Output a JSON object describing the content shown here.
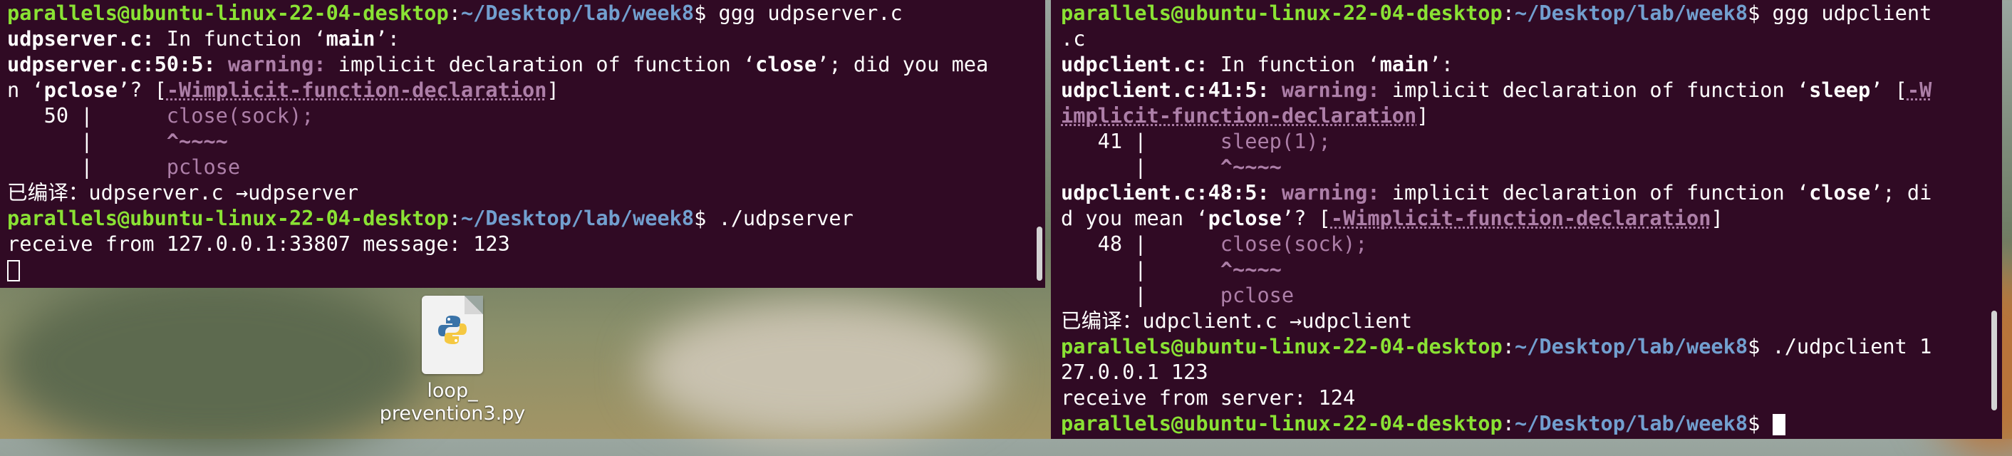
{
  "desktop": {
    "file_name": "loop_\nprevention3.py",
    "file_icon": "python-file-icon"
  },
  "left_terminal": {
    "lines": [
      {
        "prompt_user": "parallels@ubuntu-linux-22-04-desktop",
        "prompt_sep": ":",
        "prompt_path": "~/Desktop/lab/week8",
        "prompt_end": "$ ",
        "cmd": "ggg udpserver.c"
      },
      {
        "file": "udpserver.c:",
        "text": " In function ",
        "q1": "‘",
        "func": "main",
        "q2": "’:"
      },
      {
        "loc": "udpserver.c:50:5:",
        "warn": " warning:",
        "msg": " implicit declaration of function ‘",
        "sym": "close",
        "msg2": "’; did you mea"
      },
      {
        "text": "n ‘",
        "sym": "pclose",
        "text2": "’? [",
        "flag": "-Wimplicit-function-declaration",
        "text3": "]"
      },
      {
        "gutter": "   50 |     ",
        "code": " close(sock);"
      },
      {
        "gutter": "      |     ",
        "code": " ^~~~~"
      },
      {
        "gutter": "      |     ",
        "code": " pclose"
      },
      {
        "cjk": "已编译：",
        "text": "udpserver.c →udpserver"
      },
      {
        "prompt_user": "parallels@ubuntu-linux-22-04-desktop",
        "prompt_sep": ":",
        "prompt_path": "~/Desktop/lab/week8",
        "prompt_end": "$ ",
        "cmd": "./udpserver"
      },
      {
        "text": "receive from 127.0.0.1:33807 message: 123"
      }
    ]
  },
  "right_terminal": {
    "lines": [
      {
        "prompt_user": "parallels@ubuntu-linux-22-04-desktop",
        "prompt_sep": ":",
        "prompt_path": "~/Desktop/lab/week8",
        "prompt_end": "$ ",
        "cmd": "ggg udpclient"
      },
      {
        "text": ".c"
      },
      {
        "file": "udpclient.c:",
        "text": " In function ",
        "q1": "‘",
        "func": "main",
        "q2": "’:"
      },
      {
        "loc": "udpclient.c:41:5:",
        "warn": " warning:",
        "msg": " implicit declaration of function ‘",
        "sym": "sleep",
        "msg2": "’ [",
        "flag": "-W"
      },
      {
        "flag": "implicit-function-declaration",
        "text": "]"
      },
      {
        "gutter": "   41 |     ",
        "code": " sleep(1);"
      },
      {
        "gutter": "      |     ",
        "code": " ^~~~~"
      },
      {
        "loc": "udpclient.c:48:5:",
        "warn": " warning:",
        "msg": " implicit declaration of function ‘",
        "sym": "close",
        "msg2": "’; di"
      },
      {
        "text": "d you mean ‘",
        "sym": "pclose",
        "text2": "’? [",
        "flag": "-Wimplicit-function-declaration",
        "text3": "]"
      },
      {
        "gutter": "   48 |     ",
        "code": " close(sock);"
      },
      {
        "gutter": "      |     ",
        "code": " ^~~~~"
      },
      {
        "gutter": "      |     ",
        "code": " pclose"
      },
      {
        "cjk": "已编译：",
        "text": "udpclient.c →udpclient"
      },
      {
        "prompt_user": "parallels@ubuntu-linux-22-04-desktop",
        "prompt_sep": ":",
        "prompt_path": "~/Desktop/lab/week8",
        "prompt_end": "$ ",
        "cmd": "./udpclient 1"
      },
      {
        "text": "27.0.0.1 123"
      },
      {
        "text": "receive from server: 124"
      },
      {
        "prompt_user": "parallels@ubuntu-linux-22-04-desktop",
        "prompt_sep": ":",
        "prompt_path": "~/Desktop/lab/week8",
        "prompt_end": "$ ",
        "cmd": ""
      }
    ]
  }
}
